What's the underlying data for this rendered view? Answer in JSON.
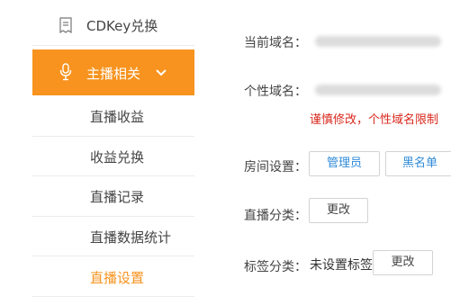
{
  "sidebar": {
    "cdkey": {
      "label": "CDKey兑换",
      "icon": "document-icon"
    },
    "active_section": {
      "label": "主播相关",
      "icon": "microphone-icon",
      "chevron": "chevron-down-icon",
      "color": "#f7931e"
    },
    "items": [
      {
        "label": "直播收益"
      },
      {
        "label": "收益兑换"
      },
      {
        "label": "直播记录"
      },
      {
        "label": "直播数据统计"
      },
      {
        "label": "直播设置",
        "current": true
      }
    ]
  },
  "main": {
    "current_domain": {
      "label": "当前域名："
    },
    "custom_domain": {
      "label": "个性域名："
    },
    "domain_warning": "谨慎修改，个性域名限制",
    "room_settings": {
      "label": "房间设置：",
      "admin_button": "管理员",
      "blacklist_button": "黑名单"
    },
    "live_category": {
      "label": "直播分类：",
      "change_button": "更改"
    },
    "tag_category": {
      "label": "标签分类：",
      "value": "未设置标签",
      "change_button": "更改"
    }
  }
}
